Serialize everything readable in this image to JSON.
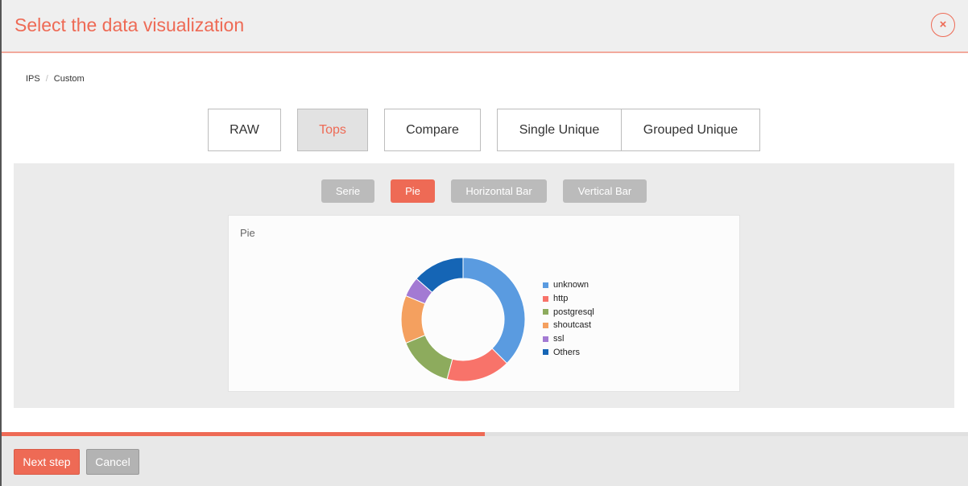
{
  "modal": {
    "title": "Select the data visualization",
    "close_label": "×"
  },
  "breadcrumb": [
    "IPS",
    "Custom"
  ],
  "breadcrumb_separator": "/",
  "view_tabs": [
    {
      "label": "RAW",
      "active": false
    },
    {
      "label": "Tops",
      "active": true
    },
    {
      "label": "Compare",
      "active": false
    },
    {
      "label": "Single Unique",
      "active": false
    },
    {
      "label": "Grouped Unique",
      "active": false
    }
  ],
  "chart_types": [
    {
      "label": "Serie",
      "active": false
    },
    {
      "label": "Pie",
      "active": true
    },
    {
      "label": "Horizontal Bar",
      "active": false
    },
    {
      "label": "Vertical Bar",
      "active": false
    }
  ],
  "chart_data": {
    "type": "pie",
    "title": "Pie",
    "donut": true,
    "categories": [
      "unknown",
      "http",
      "postgresql",
      "shoutcast",
      "ssl",
      "Others"
    ],
    "values": [
      36,
      16,
      14,
      12,
      5,
      13
    ],
    "colors": [
      "#5a9be0",
      "#f8736a",
      "#8dab5d",
      "#f4a05f",
      "#a37ad3",
      "#1565b5"
    ],
    "legend": "right"
  },
  "progress": {
    "value": 0.5
  },
  "footer": {
    "next_label": "Next step",
    "cancel_label": "Cancel"
  },
  "colors": {
    "accent": "#ee6a55",
    "inactive_button": "#bbbbbb"
  }
}
